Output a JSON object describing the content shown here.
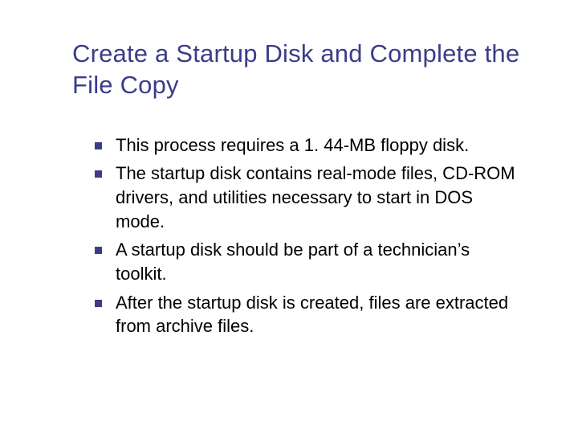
{
  "title": "Create a Startup Disk and Complete the File Copy",
  "bullets": [
    "This process requires a 1. 44-MB floppy disk.",
    "The startup disk contains real-mode files, CD-ROM drivers, and utilities necessary to start in DOS mode.",
    "A startup disk should be part of a technician’s toolkit.",
    "After the startup disk is created, files are extracted from archive files."
  ]
}
